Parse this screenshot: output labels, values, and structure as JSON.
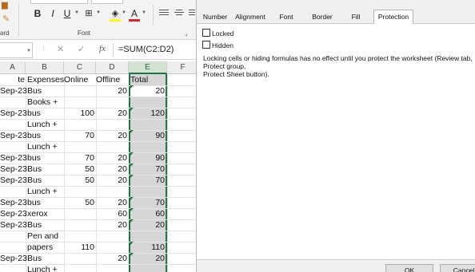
{
  "ribbon": {
    "clipboard_group": "ard",
    "font_group": "Font",
    "bold": "B",
    "italic": "I",
    "underline": "U",
    "font_color_letter": "A",
    "fill_color": "#ffff00",
    "font_color": "#d8262b"
  },
  "formula_bar": {
    "cancel": "✕",
    "enter": "✓",
    "fx": "fx",
    "formula": "=SUM(C2:D2)"
  },
  "grid": {
    "columns": [
      "A",
      "B",
      "C",
      "D",
      "E",
      "F"
    ],
    "selected_column": "E",
    "headers": {
      "a": "te",
      "b": "Expenses",
      "c": "Online",
      "d": "Offline",
      "e": "Total"
    },
    "rows": [
      {
        "a": "Sep-23",
        "b": "Bus",
        "c": "",
        "d": "20",
        "e": "20"
      },
      {
        "a": "",
        "b": "Books +",
        "c": "",
        "d": "",
        "e": ""
      },
      {
        "a": "Sep-23",
        "b": "bus",
        "c": "100",
        "d": "20",
        "e": "120"
      },
      {
        "a": "",
        "b": "Lunch +",
        "c": "",
        "d": "",
        "e": ""
      },
      {
        "a": "Sep-23",
        "b": "bus",
        "c": "70",
        "d": "20",
        "e": "90"
      },
      {
        "a": "",
        "b": "Lunch +",
        "c": "",
        "d": "",
        "e": ""
      },
      {
        "a": "Sep-23",
        "b": "bus",
        "c": "70",
        "d": "20",
        "e": "90"
      },
      {
        "a": "Sep-23",
        "b": "Bus",
        "c": "50",
        "d": "20",
        "e": "70"
      },
      {
        "a": "Sep-23",
        "b": "Bus",
        "c": "50",
        "d": "20",
        "e": "70"
      },
      {
        "a": "",
        "b": "Lunch +",
        "c": "",
        "d": "",
        "e": ""
      },
      {
        "a": "Sep-23",
        "b": "bus",
        "c": "50",
        "d": "20",
        "e": "70"
      },
      {
        "a": "Sep-23",
        "b": "xerox",
        "c": "",
        "d": "60",
        "e": "60"
      },
      {
        "a": "Sep-23",
        "b": "Bus",
        "c": "",
        "d": "20",
        "e": "20"
      },
      {
        "a": "",
        "b": "Pen and",
        "c": "",
        "d": "",
        "e": ""
      },
      {
        "a": "",
        "b": "papers",
        "c": "110",
        "d": "",
        "e": "110"
      },
      {
        "a": "Sep-23",
        "b": "Bus",
        "c": "",
        "d": "20",
        "e": "20"
      },
      {
        "a": "",
        "b": "Lunch +",
        "c": "",
        "d": "",
        "e": ""
      }
    ],
    "selection_color": "#217346"
  },
  "dialog": {
    "tabs": [
      "Number",
      "Alignment",
      "Font",
      "Border",
      "Fill",
      "Protection"
    ],
    "active_tab": "Protection",
    "locked_label": "Locked",
    "locked_checked": false,
    "hidden_label": "Hidden",
    "hidden_checked": false,
    "info_line1": "Locking cells or hiding formulas has no effect until you protect the worksheet (Review tab, Protect group,",
    "info_line2": "Protect Sheet button).",
    "ok_label": "OK",
    "cancel_label": "Cancel"
  }
}
